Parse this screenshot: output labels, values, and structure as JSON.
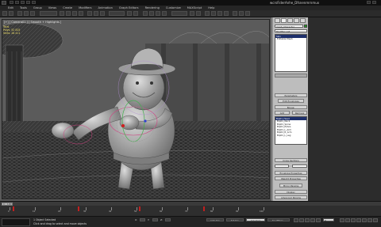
{
  "app": {
    "title": "wcrsFiderAnhe_Dfsnenmrnmux"
  },
  "menu": {
    "items": [
      "Edit",
      "Tools",
      "Group",
      "Views",
      "Create",
      "Modifiers",
      "Animation",
      "Graph Editors",
      "Rendering",
      "Customize",
      "MAXScript",
      "Help"
    ]
  },
  "viewport": {
    "label": "[+] [ Camera01 ] [ Smooth + Highlights ]",
    "stats": "Total\nPolys: 52 815\nVerts: 28 411"
  },
  "command_panel": {
    "object_name": "mesh_Character",
    "modifier_list": "Modifier List",
    "stack_items": [
      "Skin",
      "Editable Mesh"
    ],
    "section_params": "Parameters",
    "edit_envelopes": "Edit Envelopes",
    "section_bones": "Bones:",
    "add_button": "Add",
    "remove_button": "Remove",
    "bone_list": [
      "Bip01_Head",
      "Bip01_Neck",
      "Bip01_Spine",
      "Bip01_Pelvis",
      "Bip01_L_Arm",
      "Bip01_R_Arm",
      "Bip01_L_Leg"
    ],
    "section_cross": "Cross Sections",
    "section_envelope": "Envelope Properties",
    "section_weight": "Weight Properties",
    "mirror_label": "Mirror Params",
    "display_label": "Display",
    "advanced_label": "Advanced Params"
  },
  "timeline": {
    "frame_display": "0 / 100",
    "ticks": [
      "0",
      "10",
      "20",
      "30",
      "40",
      "50",
      "60",
      "70",
      "80",
      "90",
      "100"
    ]
  },
  "status": {
    "selection": "1 Object Selected",
    "prompt": "Click and drag to select and move objects",
    "x_label": "X:",
    "y_label": "Y:",
    "z_label": "Z:",
    "autokey_label": "Auto Key",
    "setkey_label": "Set Key",
    "selected_label": "Selected",
    "key_filters_label": "Key Filters...",
    "frame_value": "0"
  },
  "colors": {
    "viewport_bg": "#5a5a5a",
    "panel_bg": "#bdbdbd",
    "selection_blue": "#1d2f6b",
    "stats_yellow": "#f2e26b",
    "keyframe_red": "#c02020"
  }
}
